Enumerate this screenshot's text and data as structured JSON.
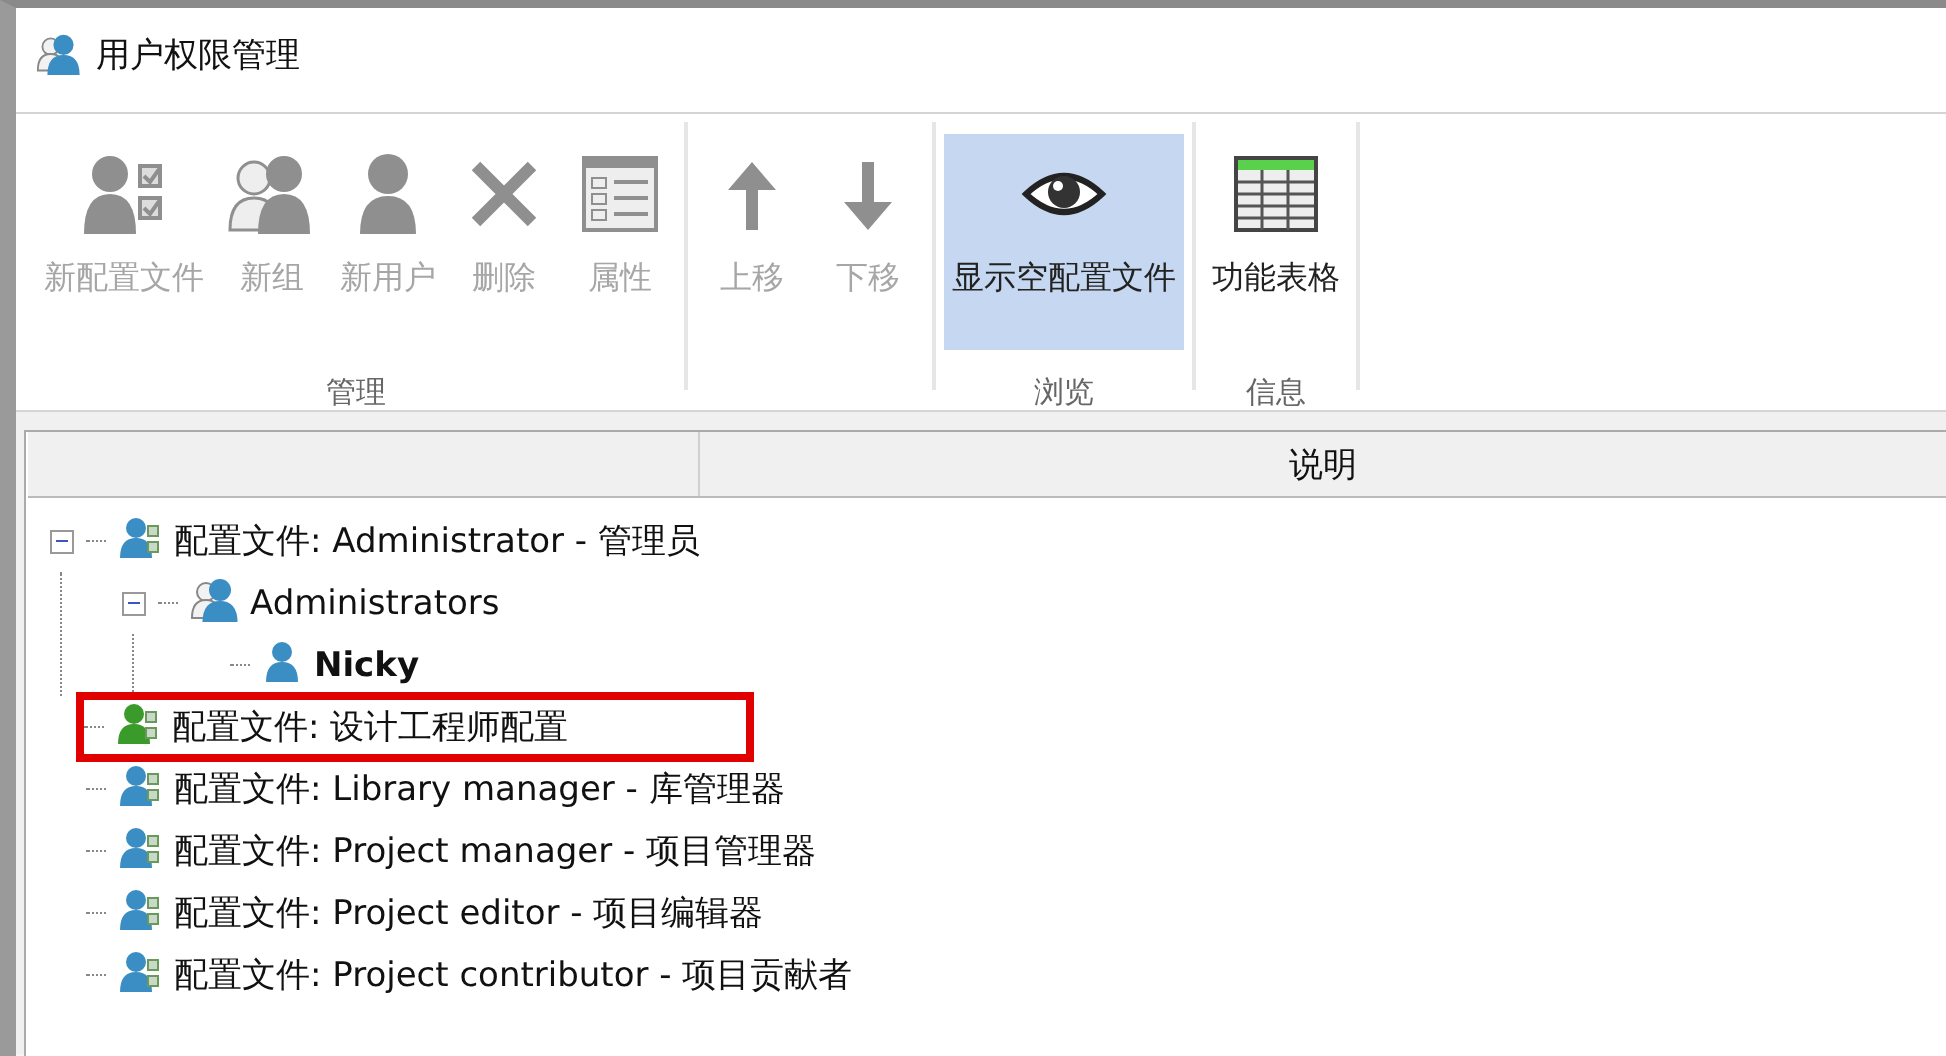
{
  "window": {
    "title": "用户权限管理"
  },
  "ribbon": {
    "groups": [
      {
        "label": "管理",
        "buttons": [
          {
            "label": "新配置文件",
            "kind": "profile",
            "disabled": true,
            "selected": false
          },
          {
            "label": "新组",
            "kind": "group",
            "disabled": true,
            "selected": false
          },
          {
            "label": "新用户",
            "kind": "user",
            "disabled": true,
            "selected": false
          },
          {
            "label": "删除",
            "kind": "delete",
            "disabled": true,
            "selected": false
          },
          {
            "label": "属性",
            "kind": "properties",
            "disabled": true,
            "selected": false
          }
        ]
      },
      {
        "buttons": [
          {
            "label": "上移",
            "kind": "up",
            "disabled": true,
            "selected": false
          },
          {
            "label": "下移",
            "kind": "down",
            "disabled": true,
            "selected": false
          }
        ]
      },
      {
        "label": "浏览",
        "buttons": [
          {
            "label": "显示空配置文件",
            "kind": "eye",
            "disabled": false,
            "selected": true
          }
        ]
      },
      {
        "label": "信息",
        "buttons": [
          {
            "label": "功能表格",
            "kind": "table",
            "disabled": false,
            "selected": false
          }
        ]
      }
    ]
  },
  "tree": {
    "columns": [
      {
        "label": "说明"
      }
    ],
    "items": [
      {
        "label": "配置文件: Administrator - 管理员",
        "kind": "profile",
        "color": "#3b8ec4",
        "expanded": true,
        "highlighted": false,
        "bold": false,
        "children": [
          {
            "label": "Administrators",
            "kind": "group",
            "color": "#3b8ec4",
            "expanded": true,
            "highlighted": false,
            "bold": false,
            "children": [
              {
                "label": "Nicky",
                "kind": "user",
                "color": "#3b8ec4",
                "bold": true,
                "highlighted": false
              }
            ]
          }
        ]
      },
      {
        "label": "配置文件: 设计工程师配置",
        "kind": "profile",
        "color": "#3a9a2a",
        "highlighted": true,
        "bold": false
      },
      {
        "label": "配置文件: Library manager - 库管理器",
        "kind": "profile",
        "color": "#3b8ec4",
        "highlighted": false,
        "bold": false
      },
      {
        "label": "配置文件: Project manager - 项目管理器",
        "kind": "profile",
        "color": "#3b8ec4",
        "highlighted": false,
        "bold": false
      },
      {
        "label": "配置文件: Project editor - 项目编辑器",
        "kind": "profile",
        "color": "#3b8ec4",
        "highlighted": false,
        "bold": false
      },
      {
        "label": "配置文件: Project contributor - 项目贡献者",
        "kind": "profile",
        "color": "#3b8ec4",
        "highlighted": false,
        "bold": false
      }
    ]
  }
}
